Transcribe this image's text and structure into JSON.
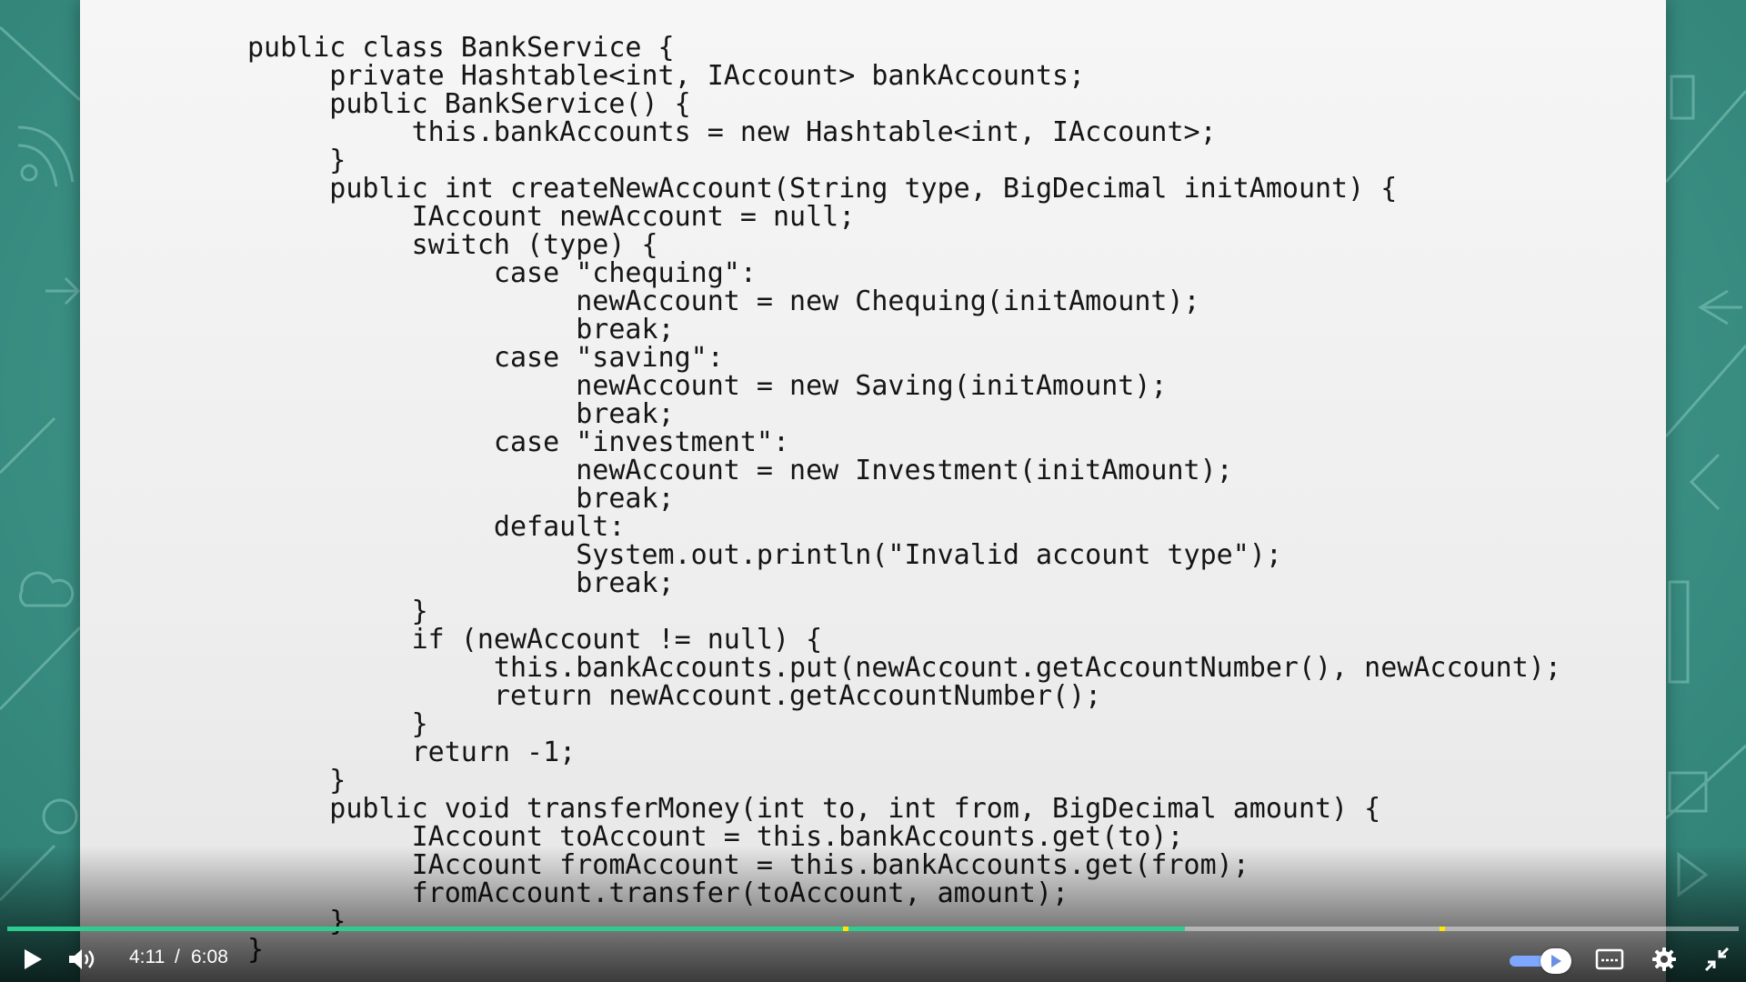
{
  "player": {
    "current_time": "4:11",
    "separator": "/",
    "duration": "6:08",
    "progress_fraction": 0.68
  },
  "icons": [
    "play-icon",
    "volume-icon",
    "cc-icon",
    "settings-icon",
    "exit-fullscreen-icon"
  ],
  "colors": {
    "accent": "#2ecc8f",
    "chapter_marker": "#ffe600",
    "background": "#3f9488"
  },
  "code_lines": [
    "public class BankService {",
    "     private Hashtable<int, IAccount> bankAccounts;",
    "     public BankService() {",
    "          this.bankAccounts = new Hashtable<int, IAccount>;",
    "     }",
    "     public int createNewAccount(String type, BigDecimal initAmount) {",
    "          IAccount newAccount = null;",
    "          switch (type) {",
    "               case \"chequing\":",
    "                    newAccount = new Chequing(initAmount);",
    "                    break;",
    "               case \"saving\":",
    "                    newAccount = new Saving(initAmount);",
    "                    break;",
    "               case \"investment\":",
    "                    newAccount = new Investment(initAmount);",
    "                    break;",
    "               default:",
    "                    System.out.println(\"Invalid account type\");",
    "                    break;",
    "          }",
    "          if (newAccount != null) {",
    "               this.bankAccounts.put(newAccount.getAccountNumber(), newAccount);",
    "               return newAccount.getAccountNumber();",
    "          }",
    "          return -1;",
    "     }",
    "     public void transferMoney(int to, int from, BigDecimal amount) {",
    "          IAccount toAccount = this.bankAccounts.get(to);",
    "          IAccount fromAccount = this.bankAccounts.get(from);",
    "          fromAccount.transfer(toAccount, amount);",
    "     }",
    "}"
  ]
}
